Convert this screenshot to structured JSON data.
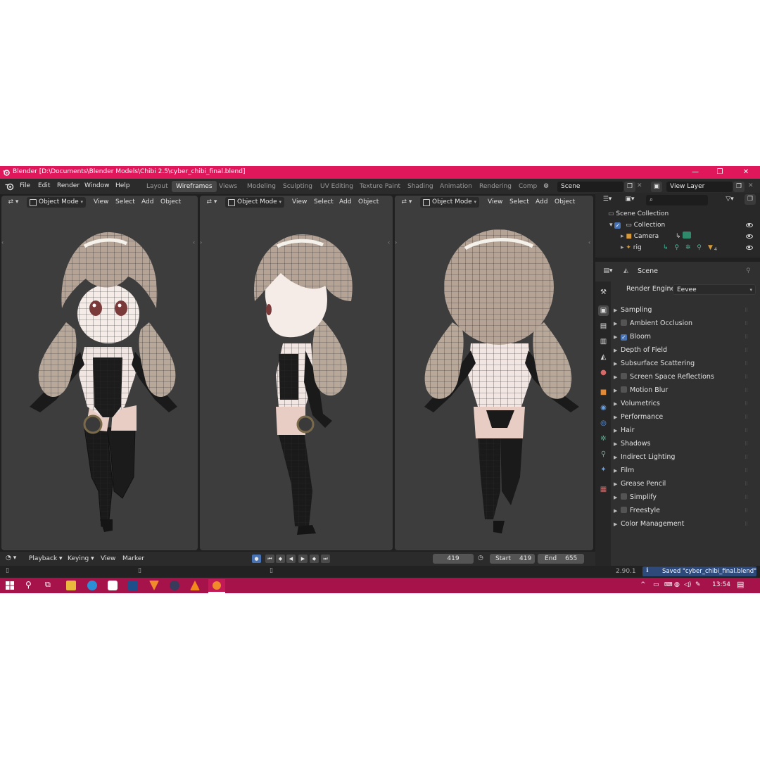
{
  "window": {
    "title": "Blender [D:\\Documents\\Blender Models\\Chibi 2.5\\cyber_chibi_final.blend]",
    "buttons": [
      "—",
      "❐",
      "✕"
    ]
  },
  "menubar": {
    "items": [
      "File",
      "Edit",
      "Render",
      "Window",
      "Help"
    ],
    "workspaces": [
      "Layout",
      "Wireframes",
      "Views",
      "Modeling",
      "Sculpting",
      "UV Editing",
      "Texture Paint",
      "Shading",
      "Animation",
      "Rendering",
      "Comp"
    ],
    "active_workspace": "Wireframes",
    "scene": "Scene",
    "view_layer": "View Layer"
  },
  "viewports": [
    {
      "mode": "Object Mode",
      "menus": [
        "View",
        "Select",
        "Add",
        "Object"
      ]
    },
    {
      "mode": "Object Mode",
      "menus": [
        "View",
        "Select",
        "Add",
        "Object"
      ]
    },
    {
      "mode": "Object Mode",
      "menus": [
        "View",
        "Select",
        "Add",
        "Object"
      ]
    }
  ],
  "outliner": {
    "scene_collection": "Scene Collection",
    "collection": "Collection",
    "objects": [
      "Camera",
      "rig"
    ],
    "rig_badge": "4"
  },
  "properties": {
    "context": "Scene",
    "render_engine_label": "Render Engine",
    "render_engine": "Eevee",
    "panels": [
      {
        "label": "Sampling",
        "checkbox": null
      },
      {
        "label": "Ambient Occlusion",
        "checkbox": false
      },
      {
        "label": "Bloom",
        "checkbox": true
      },
      {
        "label": "Depth of Field",
        "checkbox": null
      },
      {
        "label": "Subsurface Scattering",
        "checkbox": null
      },
      {
        "label": "Screen Space Reflections",
        "checkbox": false
      },
      {
        "label": "Motion Blur",
        "checkbox": false
      },
      {
        "label": "Volumetrics",
        "checkbox": null
      },
      {
        "label": "Performance",
        "checkbox": null
      },
      {
        "label": "Hair",
        "checkbox": null
      },
      {
        "label": "Shadows",
        "checkbox": null
      },
      {
        "label": "Indirect Lighting",
        "checkbox": null
      },
      {
        "label": "Film",
        "checkbox": null
      },
      {
        "label": "Grease Pencil",
        "checkbox": null
      },
      {
        "label": "Simplify",
        "checkbox": false
      },
      {
        "label": "Freestyle",
        "checkbox": false
      },
      {
        "label": "Color Management",
        "checkbox": null
      }
    ]
  },
  "timeline": {
    "menus": [
      "Playback",
      "Keying",
      "View",
      "Marker"
    ],
    "current_frame": "419",
    "start_label": "Start",
    "start": "419",
    "end_label": "End",
    "end": "655"
  },
  "statusbar": {
    "version": "2.90.1",
    "message": "Saved \"cyber_chibi_final.blend\""
  },
  "taskbar": {
    "time": "13:54"
  },
  "colors": {
    "titlebar": "#e0175a",
    "taskbar": "#a5134a",
    "viewport": "#3d3d3d",
    "accent": "#4772b3"
  }
}
